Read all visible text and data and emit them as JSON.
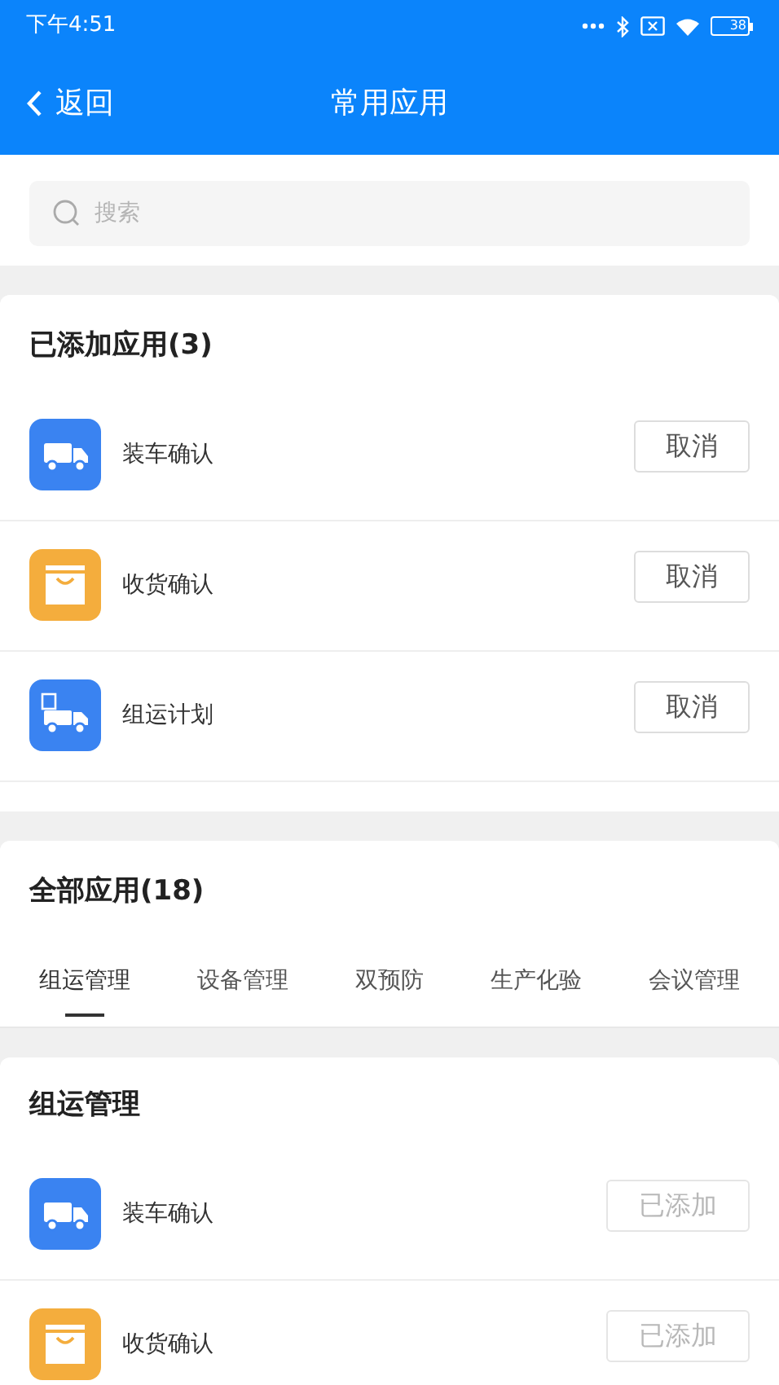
{
  "status_bar": {
    "time": "下午4:51",
    "battery": "38"
  },
  "nav": {
    "back": "返回",
    "title": "常用应用"
  },
  "search": {
    "placeholder": "搜索"
  },
  "added": {
    "title": "已添加应用(3)",
    "items": [
      {
        "name": "装车确认",
        "kind": "truck",
        "button": "取消",
        "disabled": false
      },
      {
        "name": "收货确认",
        "kind": "bag",
        "button": "取消",
        "disabled": false
      },
      {
        "name": "组运计划",
        "kind": "plan",
        "button": "取消",
        "disabled": false
      }
    ]
  },
  "all": {
    "title": "全部应用(18)",
    "tabs": [
      {
        "label": "组运管理",
        "selected": true
      },
      {
        "label": "设备管理",
        "selected": false
      },
      {
        "label": "双预防",
        "selected": false
      },
      {
        "label": "生产化验",
        "selected": false
      },
      {
        "label": "会议管理",
        "selected": false
      }
    ]
  },
  "group": {
    "title": "组运管理",
    "items": [
      {
        "name": "装车确认",
        "kind": "truck",
        "button": "已添加",
        "disabled": true
      },
      {
        "name": "收货确认",
        "kind": "bag",
        "button": "已添加",
        "disabled": true
      }
    ]
  }
}
